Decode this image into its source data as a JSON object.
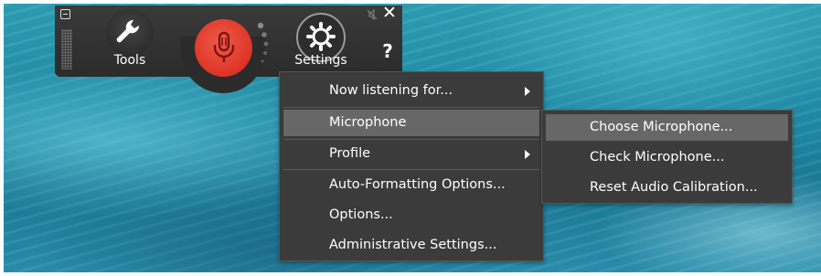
{
  "toolbar": {
    "tools_label": "Tools",
    "settings_label": "Settings",
    "close_glyph": "✕",
    "help_glyph": "?",
    "mic_state_color": "#dc3426",
    "icons": [
      "minimize-icon",
      "grip-icon",
      "wrench-icon",
      "microphone-icon",
      "volume-dots-icon",
      "gear-icon",
      "mute-icon",
      "close-icon",
      "help-icon"
    ]
  },
  "settings_menu": {
    "items": [
      {
        "label": "Now listening for...",
        "submenu": true,
        "highlighted": false
      },
      {
        "label": "Microphone",
        "submenu": true,
        "highlighted": true
      },
      {
        "label": "Profile",
        "submenu": true,
        "highlighted": false
      },
      {
        "label": "Auto-Formatting Options...",
        "submenu": false,
        "highlighted": false
      },
      {
        "label": "Options...",
        "submenu": false,
        "highlighted": false
      },
      {
        "label": "Administrative Settings...",
        "submenu": false,
        "highlighted": false
      }
    ]
  },
  "microphone_submenu": {
    "items": [
      {
        "label": "Choose Microphone...",
        "highlighted": true
      },
      {
        "label": "Check Microphone...",
        "highlighted": false
      },
      {
        "label": "Reset Audio Calibration...",
        "highlighted": false
      }
    ]
  }
}
